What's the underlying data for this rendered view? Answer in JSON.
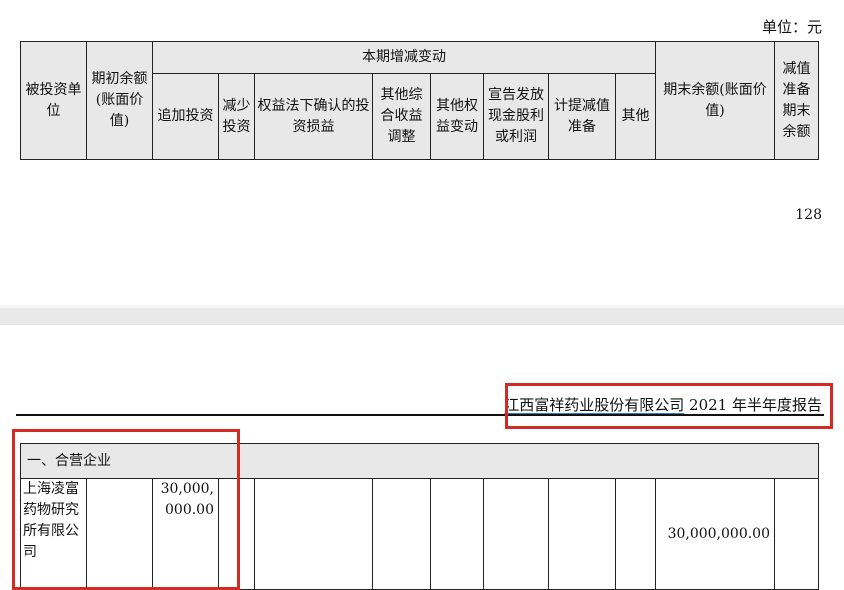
{
  "unit_label": "单位：元",
  "header": {
    "investee": "被投资单位",
    "opening": "期初余额(账面价值)",
    "change_group": "本期增减变动",
    "sub": [
      "追加投资",
      "减少投资",
      "权益法下确认的投资损益",
      "其他综合收益调整",
      "其他权益变动",
      "宣告发放现金股利或利润",
      "计提减值准备",
      "其他"
    ],
    "closing": "期末余额(账面价值)",
    "impairment": "减值准备期末余额"
  },
  "page_number": "128",
  "report": {
    "company": "江西富祥药业股份有限公司",
    "rest": " 2021 年半年度报告"
  },
  "section_title": "一、合营企业",
  "row": {
    "investee": "上海凌富药物研究所有限公司",
    "opening": "",
    "add_investment": "30,000,000.00",
    "closing": "30,000,000.00"
  },
  "colors": {
    "highlight": "#d42a24",
    "underline": "#2a7fd4",
    "header_bg": "#e8e8e8"
  }
}
